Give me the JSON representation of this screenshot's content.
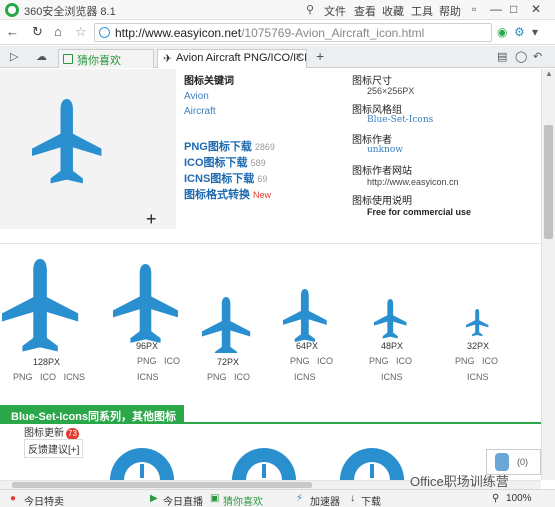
{
  "window": {
    "title": "360安全浏览器 8.1",
    "menu": [
      "文件",
      "查看",
      "收藏",
      "工具",
      "帮助"
    ]
  },
  "address": {
    "url_host": "http://www.easyicon.net",
    "url_path": "/1075769-Avion_Aircraft_icon.html"
  },
  "tabs": [
    {
      "label": "猜你喜欢"
    },
    {
      "label": "Avion Aircraft PNG/ICO/ICNS"
    }
  ],
  "keywords": {
    "title": "图标关键词",
    "items": [
      "Avion",
      "Aircraft"
    ]
  },
  "downloads": [
    {
      "label": "PNG图标下载",
      "count": "2869"
    },
    {
      "label": "ICO图标下载",
      "count": "589"
    },
    {
      "label": "ICNS图标下载",
      "count": "69"
    },
    {
      "label": "图标格式转换",
      "badge": "New"
    }
  ],
  "meta": {
    "size_label": "图标尺寸",
    "size_value": "256×256PX",
    "style_label": "图标风格组",
    "style_value": "Blue-Set-Icons",
    "author_label": "图标作者",
    "author_value": "unknow",
    "site_label": "图标作者网站",
    "site_value": "http://www.easyicon.cn",
    "usage_label": "图标使用说明",
    "usage_value": "Free for commercial use"
  },
  "sizes": [
    {
      "label": "128PX",
      "formats": [
        "PNG",
        "ICO",
        "ICNS"
      ]
    },
    {
      "label": "96PX",
      "formats": [
        "PNG",
        "ICO",
        "ICNS"
      ]
    },
    {
      "label": "72PX",
      "formats": [
        "PNG",
        "ICO"
      ]
    },
    {
      "label": "64PX",
      "formats": [
        "PNG",
        "ICO",
        "ICNS"
      ]
    },
    {
      "label": "48PX",
      "formats": [
        "PNG",
        "ICO",
        "ICNS"
      ]
    },
    {
      "label": "32PX",
      "formats": [
        "PNG",
        "ICO",
        "ICNS"
      ]
    }
  ],
  "series": {
    "title": "Blue-Set-Icons同系列，其他图标",
    "update_label": "图标更新",
    "update_badge": "73",
    "feedback": "反馈建议[+]"
  },
  "chat": {
    "count": "(0)"
  },
  "watermark": "Office职场训练营",
  "status": {
    "today": "今日特卖",
    "live": "今日直播",
    "game": "猜你喜欢",
    "accel": "加速器",
    "download": "下载",
    "zoom": "100%"
  },
  "colors": {
    "accent": "#2aa748",
    "icon_blue": "#2a8fcf",
    "link": "#1e6ab0"
  }
}
